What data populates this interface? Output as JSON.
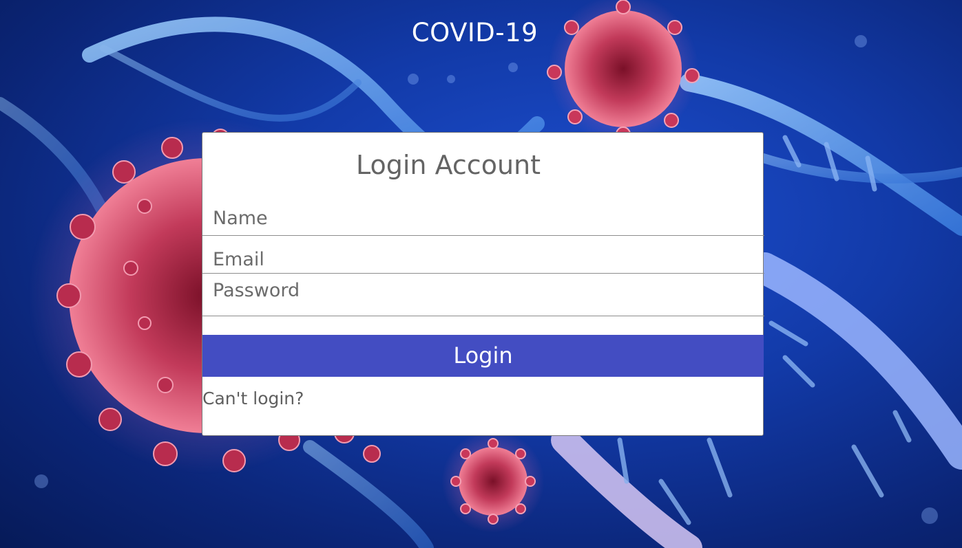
{
  "header": {
    "title": "COVID-19"
  },
  "login_form": {
    "heading": "Login Account",
    "name_placeholder": "Name",
    "email_placeholder": "Email",
    "password_placeholder": "Password",
    "submit_label": "Login",
    "help_link": "Can't login?"
  },
  "background": {
    "image": "coronavirus-and-dna-strands",
    "colors": {
      "base_blue": "#123aa8",
      "virus_red": "#d94a6a",
      "dna_blue": "#5ea0ee"
    }
  },
  "colors": {
    "button_bg": "#434dc2",
    "card_bg": "#ffffff",
    "text_gray": "#646464"
  }
}
